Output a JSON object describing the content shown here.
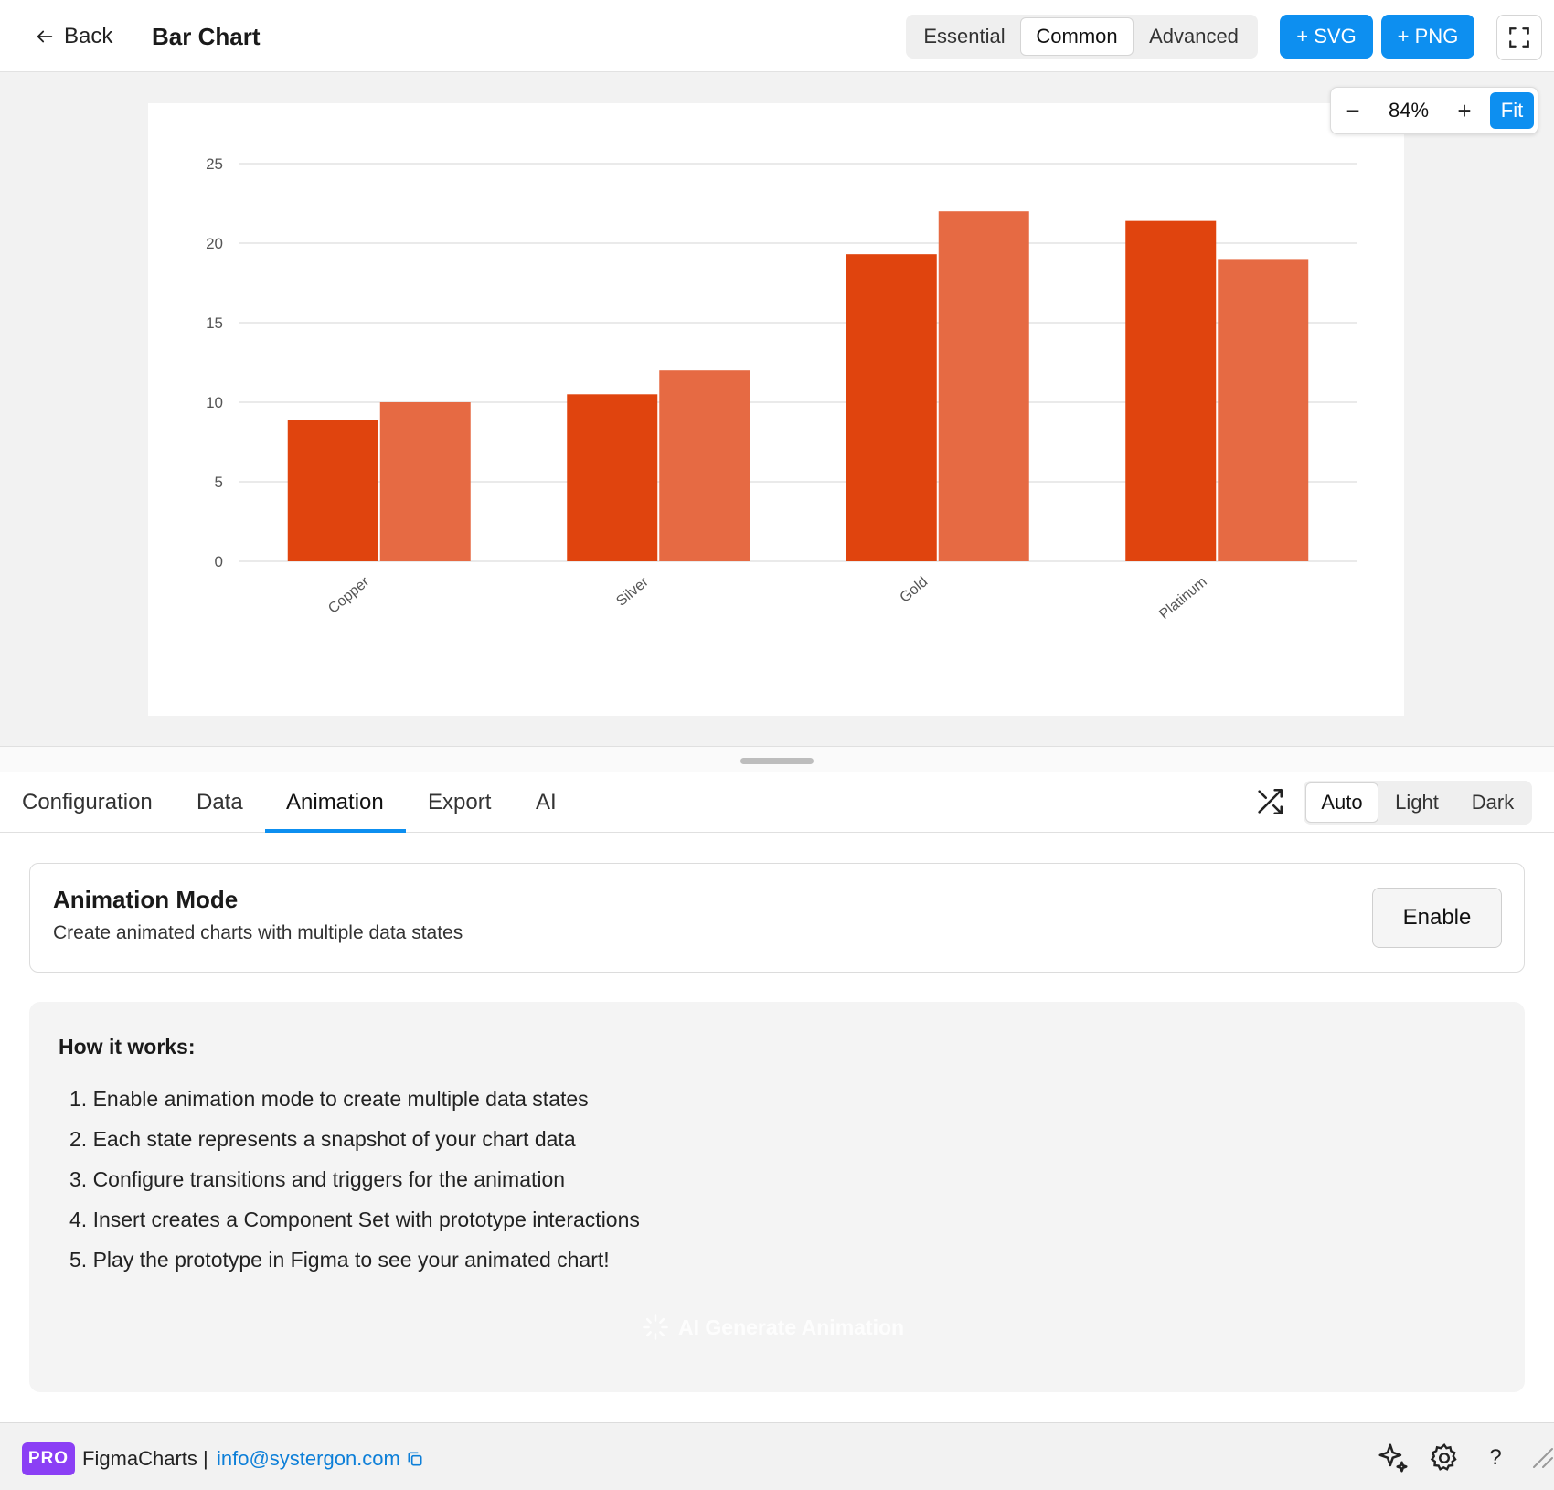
{
  "header": {
    "back_label": "Back",
    "title": "Bar Chart",
    "complexity_tabs": [
      "Essential",
      "Common",
      "Advanced"
    ],
    "active_complexity": "Common",
    "svg_button": "+ SVG",
    "png_button": "+ PNG"
  },
  "zoom": {
    "minus": "−",
    "value": "84%",
    "plus": "+",
    "fit": "Fit"
  },
  "chart_data": {
    "type": "bar",
    "categories": [
      "Copper",
      "Silver",
      "Gold",
      "Platinum"
    ],
    "series": [
      {
        "values": [
          8.9,
          10.5,
          19.3,
          21.4
        ],
        "color": "#e0440e"
      },
      {
        "values": [
          10.0,
          12.0,
          22.0,
          19.0
        ],
        "color": "#e66a43"
      }
    ],
    "yticks": [
      0,
      5,
      10,
      15,
      20,
      25
    ],
    "ylim": [
      0,
      25
    ],
    "grid": true,
    "title": "",
    "xlabel": "",
    "ylabel": ""
  },
  "tabs": {
    "items": [
      "Configuration",
      "Data",
      "Animation",
      "Export",
      "AI"
    ],
    "active": "Animation"
  },
  "theme": {
    "options": [
      "Auto",
      "Light",
      "Dark"
    ],
    "active": "Auto"
  },
  "animation_mode": {
    "title": "Animation Mode",
    "description": "Create animated charts with multiple data states",
    "enable_label": "Enable"
  },
  "how_it_works": {
    "title": "How it works:",
    "steps": [
      "1. Enable animation mode to create multiple data states",
      "2. Each state represents a snapshot of your chart data",
      "3. Configure transitions and triggers for the animation",
      "4. Insert creates a Component Set with prototype interactions",
      "5. Play the prototype in Figma to see your animated chart!"
    ],
    "ai_button": "AI Generate Animation"
  },
  "footer": {
    "badge": "PRO",
    "brand": "FigmaCharts",
    "separator": "|",
    "email": "info@systergon.com",
    "help": "?"
  },
  "colors": {
    "accent": "#0d8ff0",
    "pro": "#8b3ff5",
    "link": "#0d7fd8"
  }
}
